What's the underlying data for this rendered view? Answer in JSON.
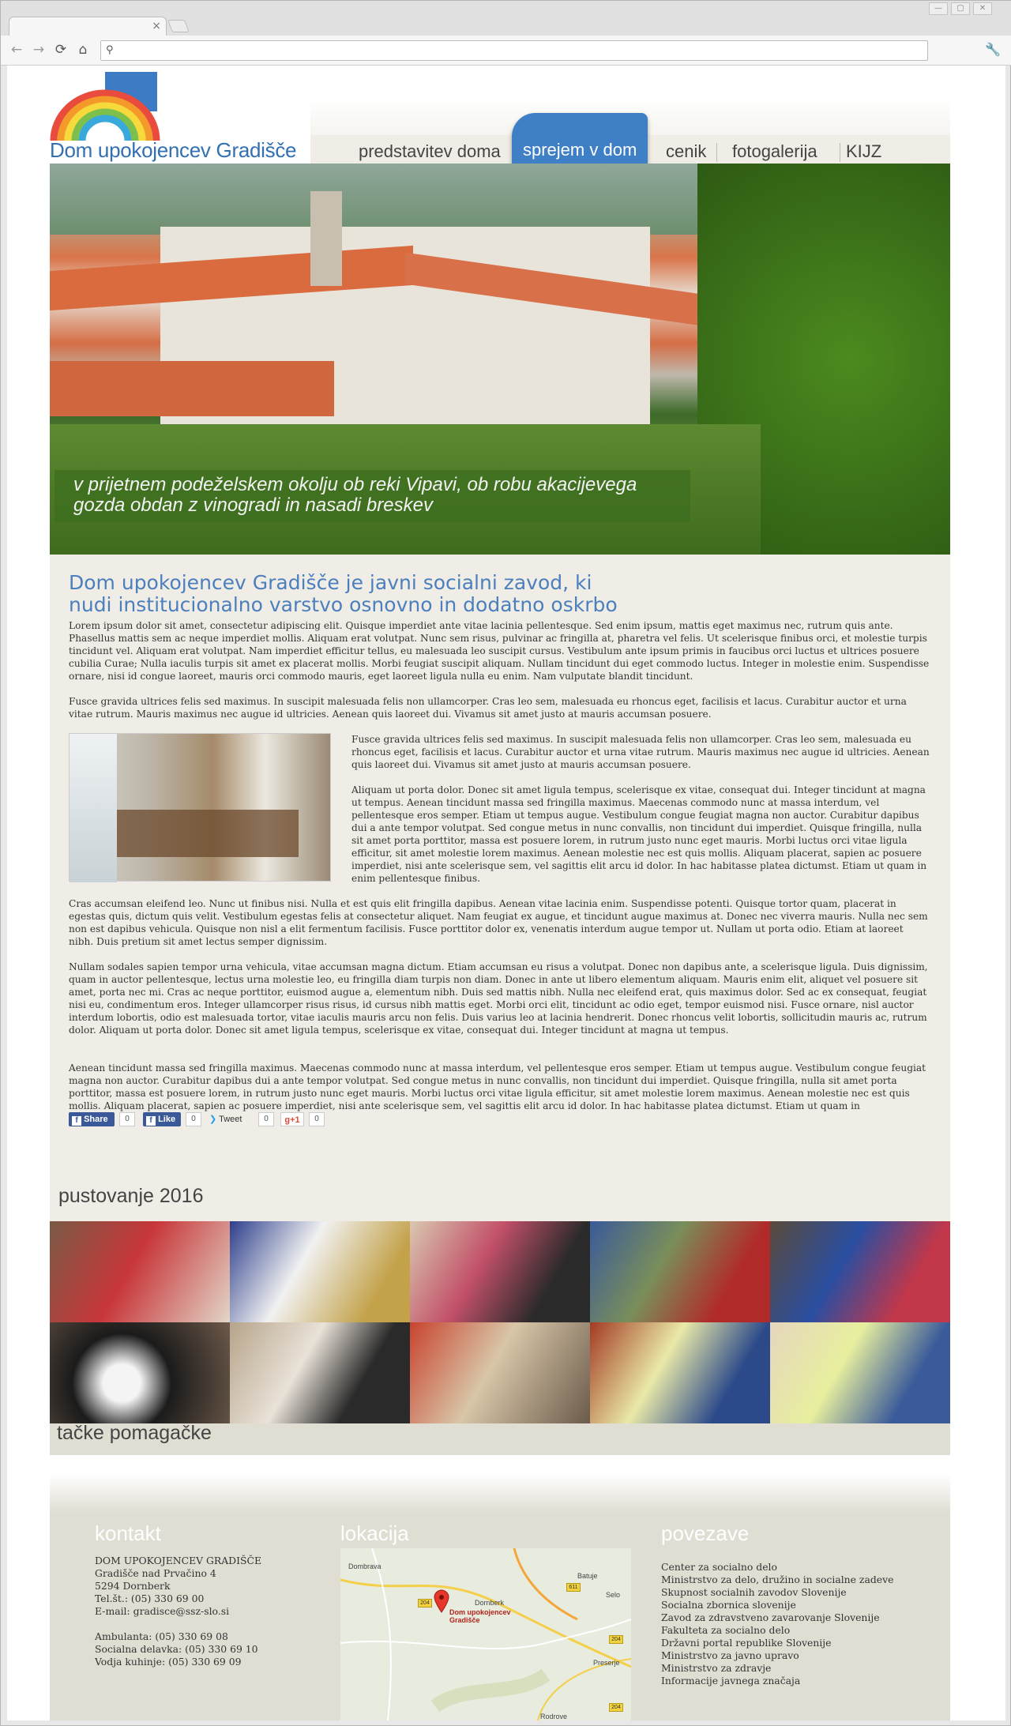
{
  "browser": {
    "tab_close": "×",
    "window_buttons": [
      "—",
      "▢",
      "✕"
    ],
    "back": "←",
    "forward": "→",
    "reload": "⟳",
    "home": "⌂",
    "search_glyph": "⚲",
    "wrench": "🔧",
    "address_value": ""
  },
  "site": {
    "logo_title": "Dom upokojencev Gradišče",
    "nav": [
      {
        "label": "predstavitev doma"
      },
      {
        "label": "sprejem v dom",
        "active": true
      },
      {
        "label": "cenik"
      },
      {
        "label": "fotogalerija"
      },
      {
        "label": "KIJZ"
      }
    ],
    "hero_caption": "v prijetnem podeželskem okolju ob reki Vipavi, ob robu akacijevega gozda obdan z vinogradi in nasadi breskev",
    "intro_heading": "Dom upokojencev Gradišče je javni socialni zavod, ki nudi institucionalno varstvo osnovno in dodatno oskrbo",
    "paragraphs": {
      "p1": "Lorem ipsum dolor sit amet, consectetur adipiscing elit. Quisque imperdiet ante vitae lacinia pellentesque. Sed enim ipsum, mattis eget maximus nec, rutrum quis ante. Phasellus mattis sem ac neque imperdiet mollis. Aliquam erat volutpat. Nunc sem risus, pulvinar ac fringilla at, pharetra vel felis. Ut scelerisque finibus orci, et molestie turpis tincidunt vel. Aliquam erat volutpat. Nam imperdiet efficitur tellus, eu malesuada leo suscipit cursus. Vestibulum ante ipsum primis in faucibus orci luctus et ultrices posuere cubilia Curae; Nulla iaculis turpis sit amet ex placerat mollis. Morbi feugiat suscipit aliquam. Nullam tincidunt dui eget commodo luctus. Integer in molestie enim. Suspendisse ornare, nisi id congue laoreet, mauris orci commodo mauris, eget laoreet ligula nulla eu enim. Nam vulputate blandit tincidunt.",
      "p2": "Fusce gravida ultrices felis sed maximus. In suscipit malesuada felis non ullamcorper. Cras leo sem, malesuada eu rhoncus eget, facilisis et lacus. Curabitur auctor et urna vitae rutrum. Mauris maximus nec augue id ultricies. Aenean quis laoreet dui. Vivamus sit amet justo at mauris accumsan posuere.",
      "p3": "Fusce gravida ultrices felis sed maximus. In suscipit malesuada felis non ullamcorper. Cras leo sem, malesuada eu rhoncus eget, facilisis et lacus. Curabitur auctor et urna vitae rutrum. Mauris maximus nec augue id ultricies. Aenean quis laoreet dui. Vivamus sit amet justo at mauris accumsan posuere.",
      "p4": "Aliquam ut porta dolor. Donec sit amet ligula tempus, scelerisque ex vitae, consequat dui. Integer tincidunt at magna ut tempus. Aenean tincidunt massa sed fringilla maximus. Maecenas commodo nunc at massa interdum, vel pellentesque eros semper. Etiam ut tempus augue. Vestibulum congue feugiat magna non auctor. Curabitur dapibus dui a ante tempor volutpat. Sed congue metus in nunc convallis, non tincidunt dui imperdiet. Quisque fringilla, nulla sit amet porta porttitor, massa est posuere lorem, in rutrum justo nunc eget mauris. Morbi luctus orci vitae ligula efficitur, sit amet molestie lorem maximus. Aenean molestie nec est quis mollis. Aliquam placerat, sapien ac posuere imperdiet, nisi ante scelerisque sem, vel sagittis elit arcu id dolor. In hac habitasse platea dictumst. Etiam ut quam in enim pellentesque finibus.",
      "p5": "Cras accumsan eleifend leo. Nunc ut finibus nisi. Nulla et est quis elit fringilla dapibus. Aenean vitae lacinia enim. Suspendisse potenti. Quisque tortor quam, placerat in egestas quis, dictum quis velit. Vestibulum egestas felis at consectetur aliquet. Nam feugiat ex augue, et tincidunt augue maximus at. Donec nec viverra mauris. Nulla nec sem non est dapibus vehicula. Quisque non nisl a elit fermentum facilisis. Fusce porttitor dolor ex, venenatis interdum augue tempor ut. Nullam ut porta odio. Etiam at laoreet nibh. Duis pretium sit amet lectus semper dignissim.",
      "p6": "Nullam sodales sapien tempor urna vehicula, vitae accumsan magna dictum. Etiam accumsan eu risus a volutpat. Donec non dapibus ante, a scelerisque ligula. Duis dignissim, quam in auctor pellentesque, lectus urna molestie leo, eu fringilla diam turpis non diam. Donec in ante ut libero elementum aliquam. Mauris enim elit, aliquet vel posuere sit amet, porta nec mi. Cras ac neque porttitor, euismod augue a, elementum nibh. Duis sed mattis nibh. Nulla nec eleifend erat, quis maximus dolor. Sed ac ex consequat, feugiat nisi eu, condimentum eros. Integer ullamcorper risus risus, id cursus nibh mattis eget. Morbi orci elit, tincidunt ac odio eget, tempor euismod nisi. Fusce ornare, nisl auctor interdum lobortis, odio est malesuada tortor, vitae iaculis mauris arcu non felis. Duis varius leo at lacinia hendrerit. Donec rhoncus velit lobortis, sollicitudin mauris ac, rutrum dolor. Aliquam ut porta dolor. Donec sit amet ligula tempus, scelerisque ex vitae, consequat dui. Integer tincidunt at magna ut tempus.",
      "p7": "Aenean tincidunt massa sed fringilla maximus. Maecenas commodo nunc at massa interdum, vel pellentesque eros semper. Etiam ut tempus augue. Vestibulum congue feugiat magna non auctor. Curabitur dapibus dui a ante tempor volutpat. Sed congue metus in nunc convallis, non tincidunt dui imperdiet. Quisque fringilla, nulla sit amet porta porttitor, massa est posuere lorem, in rutrum justo nunc eget mauris. Morbi luctus orci vitae ligula efficitur, sit amet molestie lorem maximus. Aenean molestie nec est quis mollis. Aliquam placerat, sapien ac posuere imperdiet, nisi ante scelerisque sem, vel sagittis elit arcu id dolor. In hac habitasse platea dictumst. Etiam ut quam in"
    },
    "social": {
      "share_label": "Share",
      "share_count": "0",
      "like_label": "Like",
      "like_count": "0",
      "tweet_label": "Tweet",
      "tweet_count": "0",
      "gplus_label": "+1",
      "gplus_count": "0"
    },
    "gallery": {
      "title": "pustovanje 2016",
      "subtitle": "tačke pomagačke"
    },
    "footer": {
      "kontakt": {
        "heading": "kontakt",
        "lines": [
          "DOM UPOKOJENCEV GRADIŠČE",
          "Gradišče nad Prvačino 4",
          "5294 Dornberk",
          "Tel.št.: (05) 330 69 00",
          "E-mail: gradisce@ssz-slo.si"
        ],
        "lines2": [
          "Ambulanta: (05) 330 69 08",
          "Socialna delavka: (05) 330 69 10",
          "Vodja kuhinje: (05) 330 69 09"
        ]
      },
      "lokacija": {
        "heading": "lokacija",
        "map_labels": [
          "Dombrava",
          "Batuje",
          "Selo",
          "Dornberk",
          "Preserje",
          "Rodrove"
        ],
        "marker_label": "Dom upokojencev Gradišče",
        "roads": [
          "204",
          "611",
          "204",
          "204"
        ]
      },
      "povezave": {
        "heading": "povezave",
        "links": [
          "Center za socialno delo",
          "Ministrstvo za delo, družino in socialne zadeve",
          "Skupnost socialnih zavodov Slovenije",
          "Socialna zbornica slovenije",
          "Zavod za zdravstveno zavarovanje Slovenije",
          "Fakulteta za socialno delo",
          "Državni portal republike Slovenije",
          "Ministrstvo za javno upravo",
          "Ministrstvo za zdravje",
          "Informacije javnega značaja"
        ]
      }
    }
  }
}
